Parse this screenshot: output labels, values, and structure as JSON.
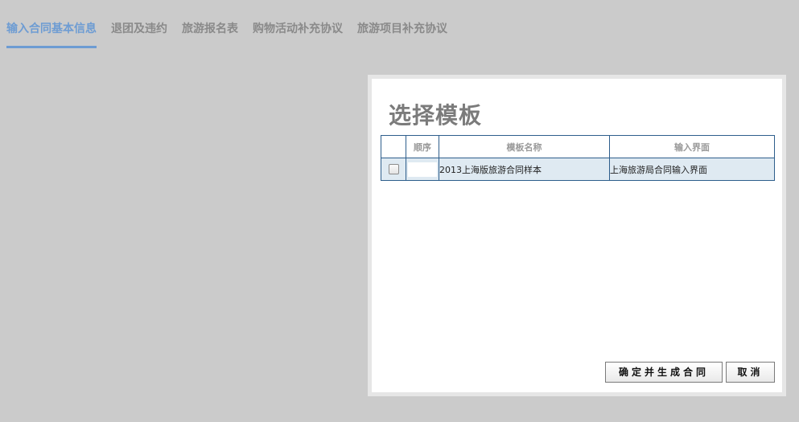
{
  "tabs": [
    {
      "label": "输入合同基本信息",
      "active": true
    },
    {
      "label": "退团及违约",
      "active": false
    },
    {
      "label": "旅游报名表",
      "active": false
    },
    {
      "label": "购物活动补充协议",
      "active": false
    },
    {
      "label": "旅游项目补充协议",
      "active": false
    }
  ],
  "modal": {
    "title": "选择模板",
    "columns": [
      "",
      "顺序",
      "模板名称",
      "输入界面"
    ],
    "rows": [
      {
        "checked": false,
        "order": "",
        "template_name": "2013上海版旅游合同样本",
        "input_interface": "上海旅游局合同输入界面"
      }
    ],
    "confirm_label": "确定并生成合同",
    "cancel_label": "取消"
  },
  "colors": {
    "background": "#cbcbcb",
    "tab_active": "#6d9cd3",
    "tab_inactive": "#8a8a8a",
    "grid_border": "#2e5e8c",
    "row_bg": "#dfeaf2"
  }
}
